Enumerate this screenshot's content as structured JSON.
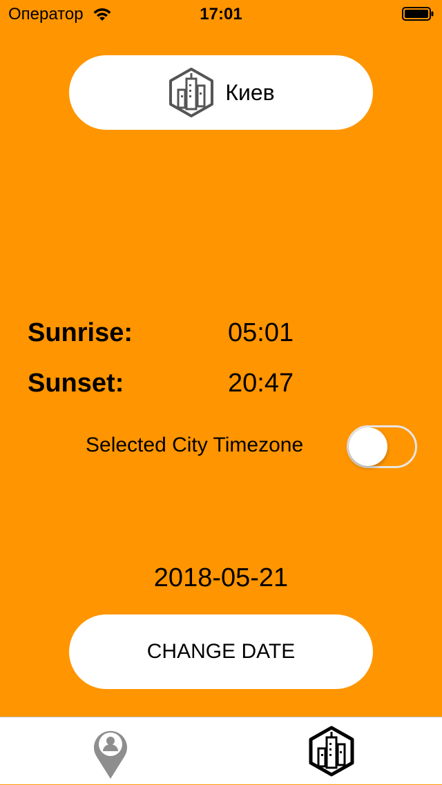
{
  "status_bar": {
    "carrier": "Оператор",
    "time": "17:01"
  },
  "city_button": {
    "label": "Киев",
    "icon": "city-buildings-icon"
  },
  "sun_times": {
    "sunrise_label": "Sunrise:",
    "sunrise_value": "05:01",
    "sunset_label": "Sunset:",
    "sunset_value": "20:47"
  },
  "timezone_toggle": {
    "label": "Selected City Timezone",
    "on": false
  },
  "date": {
    "value": "2018-05-21",
    "button_label": "CHANGE DATE"
  },
  "tab_bar": {
    "tabs": [
      {
        "icon": "location-user-pin-icon",
        "selected": false
      },
      {
        "icon": "city-buildings-icon",
        "selected": true
      }
    ]
  },
  "colors": {
    "background": "#FF9500",
    "button_background": "#FFFFFF",
    "text": "#000000",
    "inactive_tab_icon": "#8E8E8E",
    "active_tab_icon": "#000000"
  }
}
